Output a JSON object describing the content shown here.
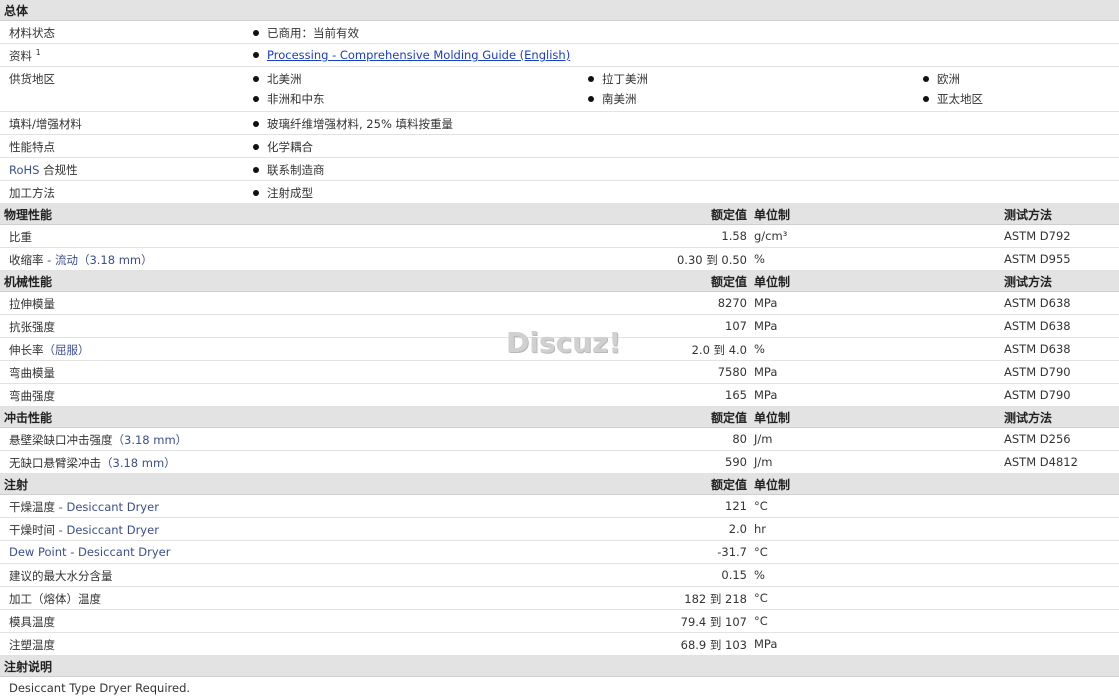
{
  "general": {
    "title": "总体",
    "material_status": {
      "label": "材料状态",
      "value": "已商用：当前有效"
    },
    "documents": {
      "label": "资料",
      "sup": "1",
      "link": "Processing - Comprehensive Molding Guide (English)"
    },
    "availability": {
      "label": "供货地区",
      "regions": [
        "北美洲",
        "拉丁美洲",
        "欧洲",
        "非洲和中东",
        "南美洲",
        "亚太地区"
      ]
    },
    "filler": {
      "label": "填料/增强材料",
      "value": "玻璃纤维增强材料, 25% 填料按重量"
    },
    "features": {
      "label": "性能特点",
      "value": "化学耦合"
    },
    "rohs": {
      "label_en": "RoHS",
      "label_cn": " 合规性",
      "value": "联系制造商"
    },
    "processing": {
      "label": "加工方法",
      "value": "注射成型"
    }
  },
  "headers": {
    "nominal": "额定值",
    "unit": "单位制",
    "method": "测试方法"
  },
  "physical": {
    "title": "物理性能",
    "rows": [
      {
        "label": "比重",
        "note": "",
        "value": "1.58",
        "unit": "g/cm³",
        "method": "ASTM D792"
      },
      {
        "label": "收缩率",
        "note": " - 流动（3.18 mm）",
        "value": "0.30 到  0.50",
        "unit": "%",
        "method": "ASTM D955"
      }
    ]
  },
  "mechanical": {
    "title": "机械性能",
    "rows": [
      {
        "label": "拉伸模量",
        "note": "",
        "value": "8270",
        "unit": "MPa",
        "method": "ASTM D638"
      },
      {
        "label": "抗张强度",
        "note": "",
        "value": "107",
        "unit": "MPa",
        "method": "ASTM D638"
      },
      {
        "label": "伸长率",
        "note": "（屈服）",
        "value": "2.0 到  4.0",
        "unit": "%",
        "method": "ASTM D638"
      },
      {
        "label": "弯曲模量",
        "note": "",
        "value": "7580",
        "unit": "MPa",
        "method": "ASTM D790"
      },
      {
        "label": "弯曲强度",
        "note": "",
        "value": "165",
        "unit": "MPa",
        "method": "ASTM D790"
      }
    ]
  },
  "impact": {
    "title": "冲击性能",
    "rows": [
      {
        "label": "悬壁梁缺口冲击强度",
        "note": "（3.18 mm）",
        "value": "80",
        "unit": "J/m",
        "method": "ASTM D256"
      },
      {
        "label": "无缺口悬臂梁冲击",
        "note": "（3.18 mm）",
        "value": "590",
        "unit": "J/m",
        "method": "ASTM D4812"
      }
    ]
  },
  "injection": {
    "title": "注射",
    "rows": [
      {
        "label": "干燥温度",
        "note": "  - Desiccant Dryer",
        "value": "121",
        "unit": "°C"
      },
      {
        "label": "干燥时间",
        "note": "  - Desiccant Dryer",
        "value": "2.0",
        "unit": "hr"
      },
      {
        "label": "",
        "note": "Dew Point - Desiccant Dryer",
        "value": "-31.7",
        "unit": "°C"
      },
      {
        "label": "建议的最大水分含量",
        "note": "",
        "value": "0.15",
        "unit": "%"
      },
      {
        "label": "加工（熔体）温度",
        "note": "",
        "value": "182 到  218",
        "unit": "°C"
      },
      {
        "label": "模具温度",
        "note": "",
        "value": "79.4 到  107",
        "unit": "°C"
      },
      {
        "label": "注塑温度",
        "note": "",
        "value": "68.9 到  103",
        "unit": "MPa"
      }
    ]
  },
  "injection_notes": {
    "title": "注射说明",
    "text": "Desiccant Type Dryer Required."
  },
  "watermark": "Discuz!"
}
